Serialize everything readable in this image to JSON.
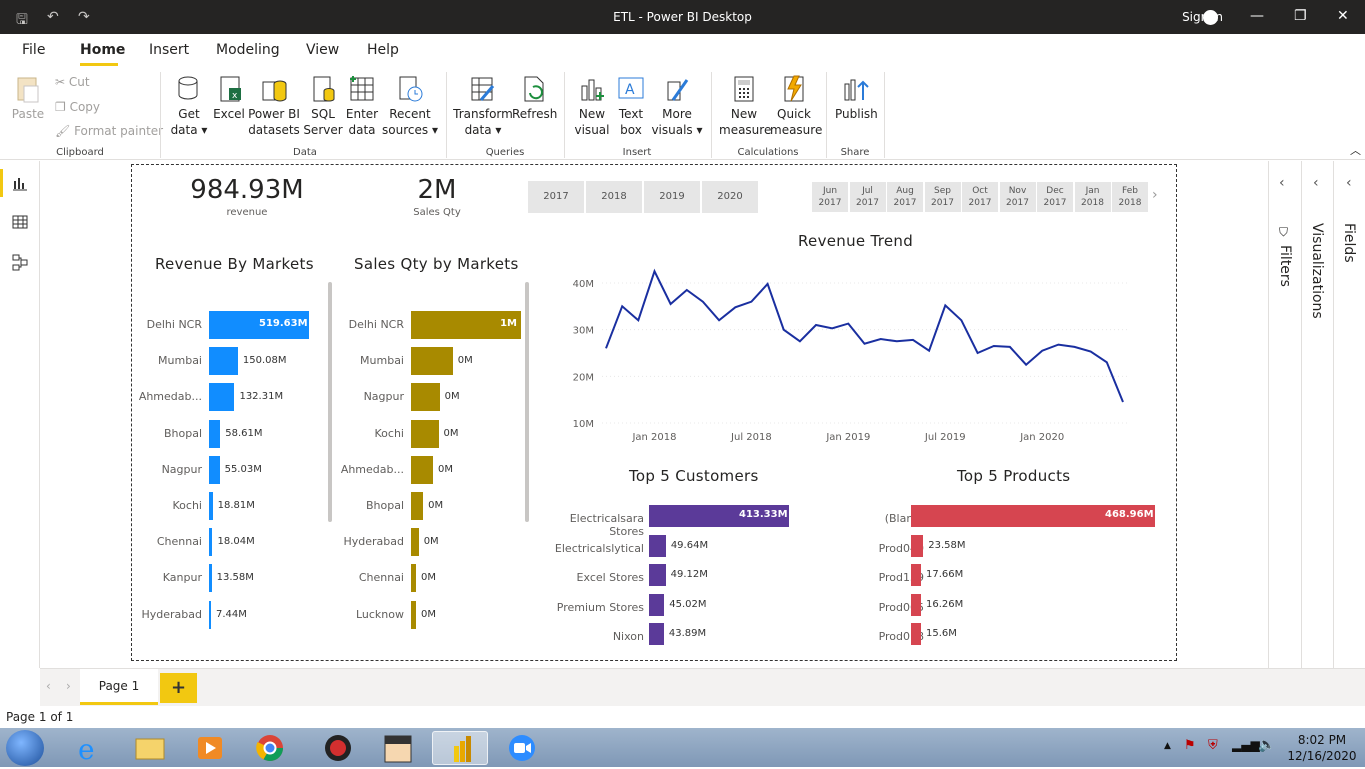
{
  "window": {
    "title": "ETL - Power BI Desktop",
    "sign_in": "Sign in"
  },
  "menu": {
    "tabs": [
      "File",
      "Home",
      "Insert",
      "Modeling",
      "View",
      "Help"
    ],
    "active": "Home"
  },
  "ribbon": {
    "clipboard": {
      "paste": "Paste",
      "cut": "Cut",
      "copy": "Copy",
      "format_painter": "Format painter",
      "group": "Clipboard"
    },
    "data": {
      "get_data": "Get data",
      "excel": "Excel",
      "pbi_datasets": "Power BI datasets",
      "sql_server": "SQL Server",
      "enter_data": "Enter data",
      "recent_sources": "Recent sources",
      "group": "Data"
    },
    "queries": {
      "transform_data": "Transform data",
      "refresh": "Refresh",
      "group": "Queries"
    },
    "insert": {
      "new_visual": "New visual",
      "text_box": "Text box",
      "more_visuals": "More visuals",
      "group": "Insert"
    },
    "calculations": {
      "new_measure": "New measure",
      "quick_measure": "Quick measure",
      "group": "Calculations"
    },
    "share": {
      "publish": "Publish",
      "group": "Share"
    }
  },
  "kpis": [
    {
      "value": "984.93M",
      "label": "revenue"
    },
    {
      "value": "2M",
      "label": "Sales Qty"
    }
  ],
  "year_slicer": [
    "2017",
    "2018",
    "2019",
    "2020"
  ],
  "month_slicer": [
    [
      "Jun",
      "2017"
    ],
    [
      "Jul",
      "2017"
    ],
    [
      "Aug",
      "2017"
    ],
    [
      "Sep",
      "2017"
    ],
    [
      "Oct",
      "2017"
    ],
    [
      "Nov",
      "2017"
    ],
    [
      "Dec",
      "2017"
    ],
    [
      "Jan",
      "2018"
    ],
    [
      "Feb",
      "2018"
    ]
  ],
  "colors": {
    "revenue_bar": "#118dff",
    "qty_bar": "#a88a00",
    "customer_bar": "#5b3a99",
    "product_bar": "#d64550",
    "trend_line": "#1a2fa0",
    "accent": "#f2c811"
  },
  "charts": {
    "revenue_by_markets": {
      "title": "Revenue By Markets",
      "categories": [
        "Delhi NCR",
        "Mumbai",
        "Ahmedab...",
        "Bhopal",
        "Nagpur",
        "Kochi",
        "Chennai",
        "Kanpur",
        "Hyderabad"
      ],
      "labels": [
        "519.63M",
        "150.08M",
        "132.31M",
        "58.61M",
        "55.03M",
        "18.81M",
        "18.04M",
        "13.58M",
        "7.44M"
      ],
      "values": [
        519.63,
        150.08,
        132.31,
        58.61,
        55.03,
        18.81,
        18.04,
        13.58,
        7.44
      ]
    },
    "sales_qty_by_markets": {
      "title": "Sales Qty by Markets",
      "categories": [
        "Delhi NCR",
        "Mumbai",
        "Nagpur",
        "Kochi",
        "Ahmedab...",
        "Bhopal",
        "Hyderabad",
        "Chennai",
        "Lucknow"
      ],
      "labels": [
        "1M",
        "0M",
        "0M",
        "0M",
        "0M",
        "0M",
        "0M",
        "0M",
        "0M"
      ],
      "values": [
        1.0,
        0.38,
        0.26,
        0.25,
        0.2,
        0.11,
        0.07,
        0.04,
        0.03
      ]
    },
    "revenue_trend": {
      "title": "Revenue Trend",
      "y_ticks": [
        "40M",
        "30M",
        "20M",
        "10M"
      ],
      "x_ticks": [
        "Jan 2018",
        "Jul 2018",
        "Jan 2019",
        "Jul 2019",
        "Jan 2020"
      ],
      "values": [
        26,
        35,
        32,
        42.5,
        35.5,
        38.5,
        36,
        32,
        34.8,
        36,
        39.8,
        30,
        27.5,
        31,
        30.3,
        31.3,
        27,
        28,
        27.5,
        27.8,
        25.5,
        35.2,
        32,
        25,
        26.5,
        26.3,
        22.5,
        25.5,
        26.8,
        26.3,
        25.3,
        23,
        14.5
      ]
    },
    "top5_customers": {
      "title": "Top 5 Customers",
      "categories": [
        "Electricalsara Stores",
        "Electricalslytical",
        "Excel Stores",
        "Premium Stores",
        "Nixon"
      ],
      "labels": [
        "413.33M",
        "49.64M",
        "49.12M",
        "45.02M",
        "43.89M"
      ],
      "values": [
        413.33,
        49.64,
        49.12,
        45.02,
        43.89
      ]
    },
    "top5_products": {
      "title": "Top 5 Products",
      "categories": [
        "(Blank)",
        "Prod040",
        "Prod159",
        "Prod065",
        "Prod018"
      ],
      "labels": [
        "468.96M",
        "23.58M",
        "17.66M",
        "16.26M",
        "15.6M"
      ],
      "values": [
        468.96,
        23.58,
        17.66,
        16.26,
        15.6
      ]
    }
  },
  "panes": {
    "filters": "Filters",
    "visualizations": "Visualizations",
    "fields": "Fields"
  },
  "pages": {
    "current": "Page 1",
    "status": "Page 1 of 1"
  },
  "clock": {
    "time": "8:02 PM",
    "date": "12/16/2020"
  }
}
